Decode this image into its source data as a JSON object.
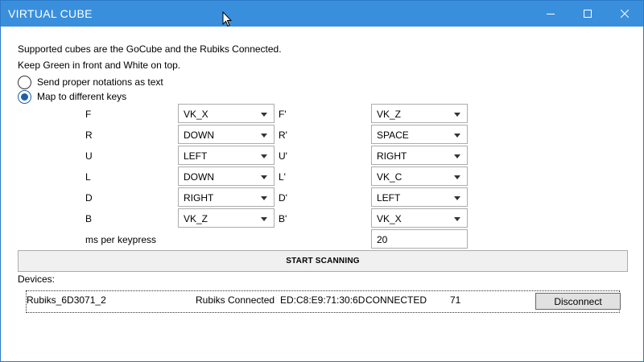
{
  "window": {
    "title": "VIRTUAL CUBE"
  },
  "info": {
    "line1": "Supported cubes are the GoCube and the Rubiks Connected.",
    "line2": "Keep Green in front and White on top."
  },
  "mode": {
    "option_text": "Send proper notations as text",
    "option_keys": "Map to different keys",
    "selected": "Map to different keys"
  },
  "mappings": [
    {
      "move": "F",
      "key": "VK_X",
      "prime_move": "F'",
      "prime_key": "VK_Z"
    },
    {
      "move": "R",
      "key": "DOWN",
      "prime_move": "R'",
      "prime_key": "SPACE"
    },
    {
      "move": "U",
      "key": "LEFT",
      "prime_move": "U'",
      "prime_key": "RIGHT"
    },
    {
      "move": "L",
      "key": "DOWN",
      "prime_move": "L'",
      "prime_key": "VK_C"
    },
    {
      "move": "D",
      "key": "RIGHT",
      "prime_move": "D'",
      "prime_key": "LEFT"
    },
    {
      "move": "B",
      "key": "VK_Z",
      "prime_move": "B'",
      "prime_key": "VK_X"
    }
  ],
  "keypress": {
    "label": "ms per keypress",
    "value": "20"
  },
  "scan_button": "START SCANNING",
  "devices": {
    "label": "Devices:",
    "items": [
      {
        "name": "Rubiks_6D3071_2",
        "type": "Rubiks Connected",
        "address": "ED:C8:E9:71:30:6D",
        "status": "CONNECTED",
        "battery": "71",
        "action": "Disconnect"
      }
    ]
  },
  "icons": {
    "minimize": "minimize-icon",
    "maximize": "maximize-icon",
    "close": "close-icon",
    "cursor": "mouse-cursor-icon",
    "dropdown": "chevron-down-icon"
  },
  "colors": {
    "titlebar": "#3a8fdc",
    "accent": "#1f5fa8"
  }
}
